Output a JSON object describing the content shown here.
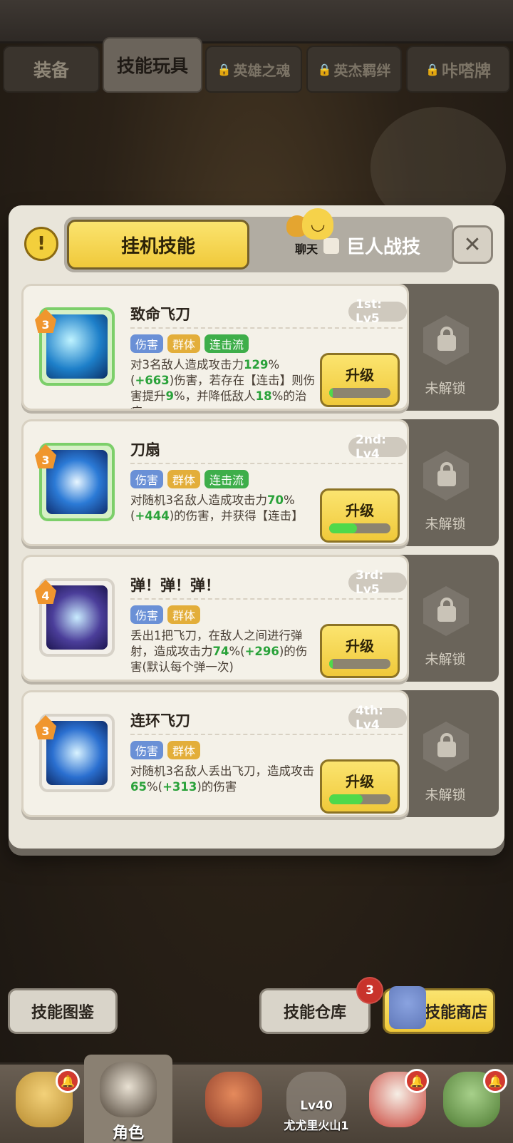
{
  "tabs": [
    {
      "label": "装备",
      "locked": false,
      "active": false
    },
    {
      "label": "技能玩具",
      "locked": false,
      "active": true
    },
    {
      "label": "英雄之魂",
      "locked": true,
      "active": false
    },
    {
      "label": "英杰羁绊",
      "locked": true,
      "active": false
    },
    {
      "label": "咔嗒牌",
      "locked": true,
      "active": false
    }
  ],
  "modal": {
    "warning_icon": "!",
    "segment_active": "挂机技能",
    "segment_other": "巨人战技",
    "chat_label": "聊天",
    "close_icon": "✕"
  },
  "skills": [
    {
      "badge": "3",
      "name": "致命飞刀",
      "rank": "1st: Lv5",
      "tags": [
        "伤害",
        "群体",
        "连击流"
      ],
      "desc_parts": [
        {
          "t": "对3名敌人造成攻击力"
        },
        {
          "t": "129",
          "g": true
        },
        {
          "t": "%("
        },
        {
          "t": "+663",
          "g": true
        },
        {
          "t": ")伤害，若存在【连击】则伤害提升"
        },
        {
          "t": "9",
          "g": true
        },
        {
          "t": "%，并降低敌人"
        },
        {
          "t": "18",
          "g": true
        },
        {
          "t": "%的治疗…"
        }
      ],
      "upgrade": "升级",
      "progress": 0.05,
      "lock_label": "未解锁",
      "frame": "green"
    },
    {
      "badge": "3",
      "name": "刀扇",
      "rank": "2nd: Lv4",
      "tags": [
        "伤害",
        "群体",
        "连击流"
      ],
      "desc_parts": [
        {
          "t": "对随机3名敌人造成攻击力"
        },
        {
          "t": "70",
          "g": true
        },
        {
          "t": "%("
        },
        {
          "t": "+444",
          "g": true
        },
        {
          "t": ")的伤害，并获得【连击】"
        }
      ],
      "upgrade": "升级",
      "progress": 0.45,
      "lock_label": "未解锁",
      "frame": "green"
    },
    {
      "badge": "4",
      "name": "弹！弹！弹！",
      "rank": "3rd: Lv5",
      "tags": [
        "伤害",
        "群体"
      ],
      "desc_parts": [
        {
          "t": "丢出1把飞刀，在敌人之间进行弹射，造成攻击力"
        },
        {
          "t": "74",
          "g": true
        },
        {
          "t": "%("
        },
        {
          "t": "+296",
          "g": true
        },
        {
          "t": ")的伤害(默认每个弹一次)"
        }
      ],
      "upgrade": "升级",
      "progress": 0.05,
      "lock_label": "未解锁",
      "frame": "white"
    },
    {
      "badge": "3",
      "name": "连环飞刀",
      "rank": "4th: Lv4",
      "tags": [
        "伤害",
        "群体"
      ],
      "desc_parts": [
        {
          "t": "对随机3名敌人丢出飞刀，造成攻击"
        },
        {
          "t": "65",
          "g": true
        },
        {
          "t": "%("
        },
        {
          "t": "+313",
          "g": true
        },
        {
          "t": ")的伤害"
        }
      ],
      "upgrade": "升级",
      "progress": 0.55,
      "lock_label": "未解锁",
      "frame": "white"
    }
  ],
  "bottom_buttons": {
    "codex": "技能图鉴",
    "warehouse": "技能仓库",
    "warehouse_badge": "3",
    "shop": "技能商店"
  },
  "nav": [
    {
      "label": "",
      "bell": true
    },
    {
      "label": "角色",
      "bell": false,
      "active": true
    },
    {
      "label": "",
      "bell": false
    },
    {
      "label": "",
      "locked": true,
      "level": "Lv40",
      "unlock_name": "尤尤里火山1"
    },
    {
      "label": "",
      "bell": true
    },
    {
      "label": "",
      "bell": true
    }
  ],
  "colors": {
    "accent_yellow": "#f0c93a",
    "progress_green": "#4fd94b",
    "desc_highlight": "#2aa23a",
    "tag_blue": "#6a90d6",
    "tag_yellow": "#e3ae3a",
    "tag_green": "#3eae4a",
    "notification_red": "#c8332b"
  }
}
